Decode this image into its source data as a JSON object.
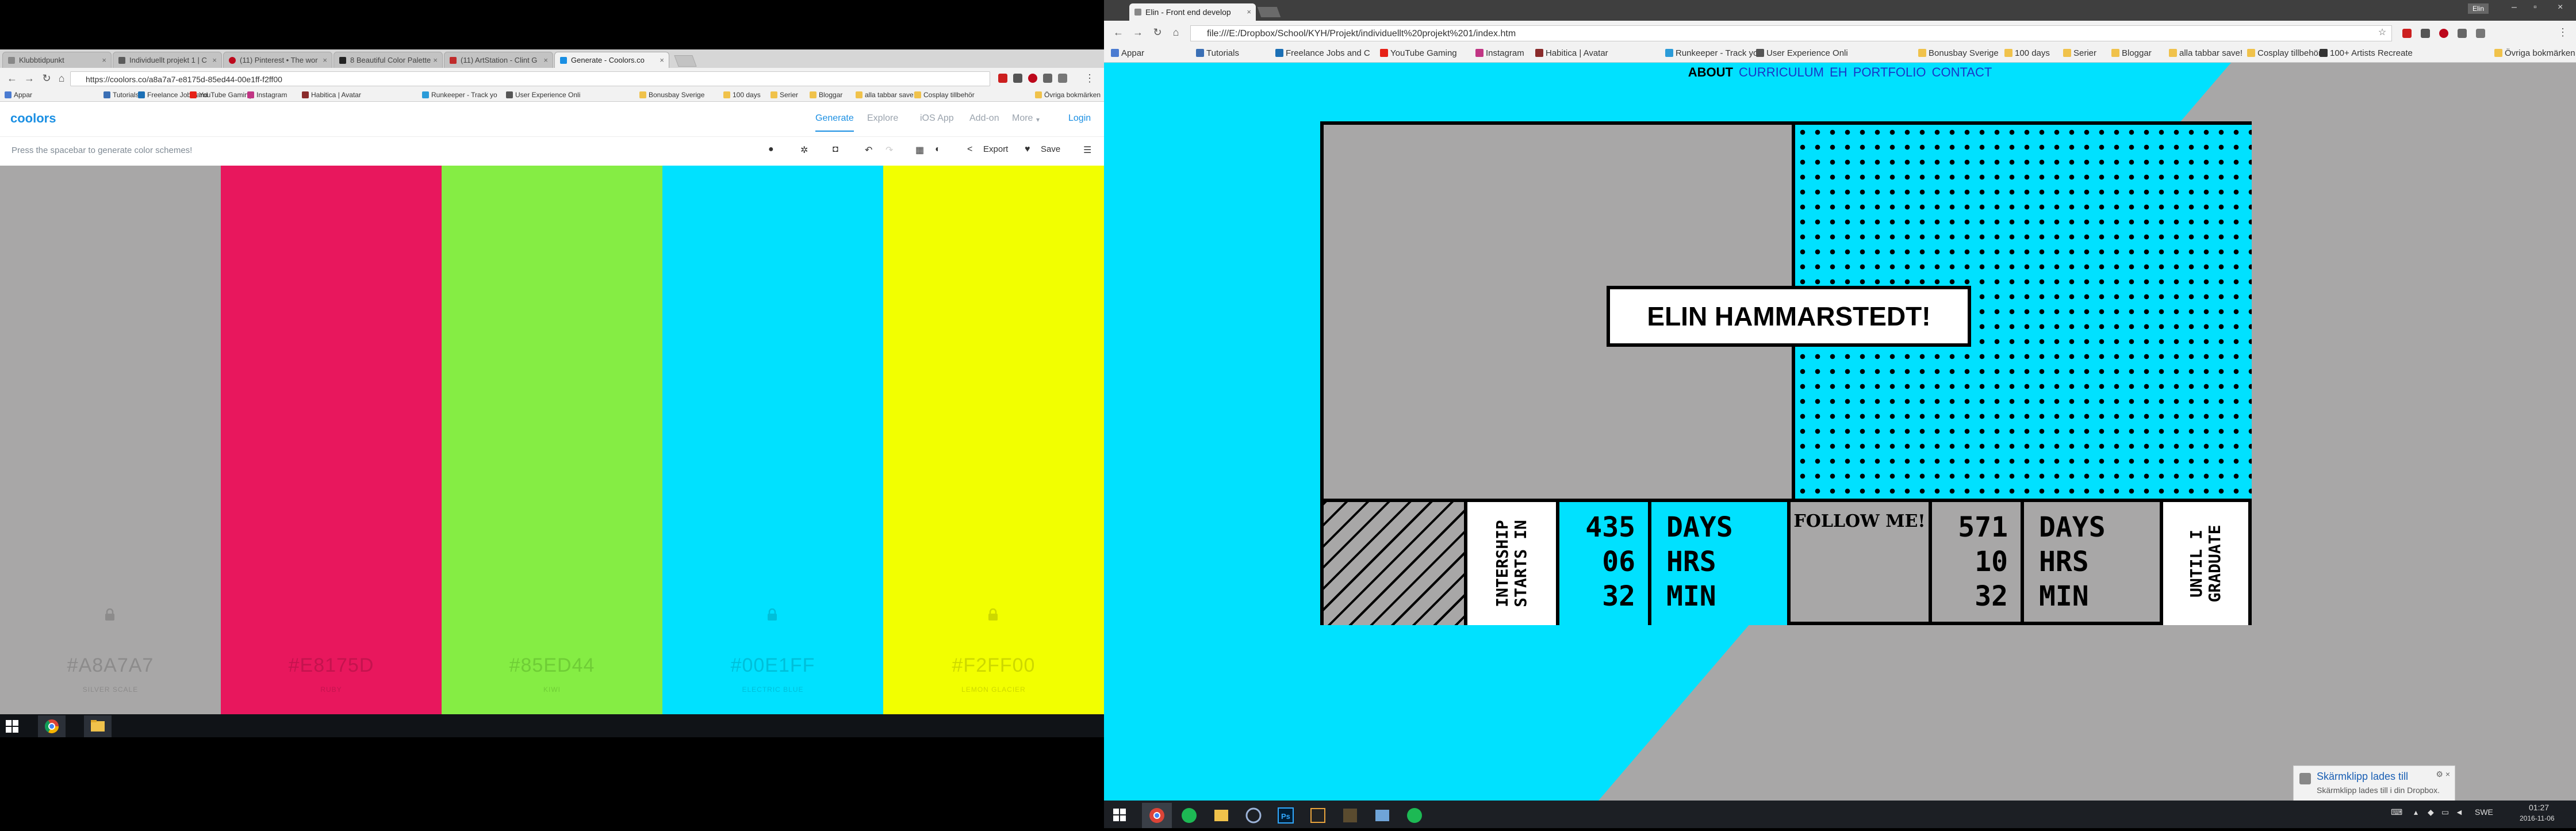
{
  "left_browser": {
    "tabs": [
      {
        "label": "Klubbtidpunkt"
      },
      {
        "label": "Individuellt projekt 1 | C"
      },
      {
        "label": "(11) Pinterest • The wor"
      },
      {
        "label": "8 Beautiful Color Palette"
      },
      {
        "label": "(11) ArtStation - Clint G"
      },
      {
        "label": "Generate - Coolors.co"
      }
    ],
    "url": "https://coolors.co/a8a7a7-e8175d-85ed44-00e1ff-f2ff00",
    "bookmarks": [
      "Appar",
      "Tutorials",
      "Freelance Jobs and",
      "YouTube Gaming",
      "Instagram",
      "Habitica | Avatar",
      "Runkeeper - Track yo",
      "User Experience Onli",
      "Bonusbay Sverige",
      "100 days",
      "Serier",
      "Bloggar",
      "alla tabbar save!",
      "Cosplay tillbehör",
      "Övriga bokmärken"
    ]
  },
  "coolors": {
    "logo": "coolors",
    "nav": {
      "generate": "Generate",
      "explore": "Explore",
      "ios_app": "iOS App",
      "addon": "Add-on",
      "more": "More",
      "login": "Login"
    },
    "hint": "Press the spacebar to generate color schemes!",
    "tools": {
      "export": "Export",
      "save": "Save"
    },
    "swatches": [
      {
        "hex": "#A8A7A7",
        "name": "SILVER SCALE",
        "color": "#a8a7a7",
        "text_color": "#8c8b8b",
        "locked": true
      },
      {
        "hex": "#E8175D",
        "name": "RUBY",
        "color": "#e8175d",
        "text_color": "#c4134e",
        "locked": false
      },
      {
        "hex": "#85ED44",
        "name": "KIWI",
        "color": "#85ed44",
        "text_color": "#6fcd36",
        "locked": false
      },
      {
        "hex": "#00E1FF",
        "name": "ELECTRIC BLUE",
        "color": "#00e1ff",
        "text_color": "#00bfd9",
        "locked": true
      },
      {
        "hex": "#F2FF00",
        "name": "LEMON GLACIER",
        "color": "#f2ff00",
        "text_color": "#cdd800",
        "locked": true
      }
    ]
  },
  "right_browser": {
    "tab": "Elin - Front end develop",
    "profile": "Elin",
    "url": "file:///E:/Dropbox/School/KYH/Projekt/individuellt%20projekt%201/index.htm",
    "bookmarks": [
      "Appar",
      "Tutorials",
      "Freelance Jobs and C",
      "YouTube Gaming",
      "Instagram",
      "Habitica | Avatar",
      "Runkeeper - Track yo",
      "User Experience Onli",
      "Bonusbay Sverige",
      "100 days",
      "Serier",
      "Bloggar",
      "alla tabbar save!",
      "Cosplay tillbehör",
      "100+ Artists Recreate",
      "Övriga bokmärken"
    ]
  },
  "site": {
    "nav": {
      "about": "ABOUT",
      "curriculum": "CURRICULUM",
      "eh": "EH",
      "portfolio": "PORTFOLIO",
      "contact": "CONTACT"
    },
    "name": "ELIN HAMMARSTEDT!",
    "internship_label": "INTERSHIP STARTS IN",
    "internship": {
      "days": "435",
      "hrs": "06",
      "min": "32"
    },
    "graduate_label": "UNTIL I GRADUATE",
    "graduate": {
      "days": "571",
      "hrs": "10",
      "min": "32"
    },
    "units": {
      "days": "DAYS",
      "hrs": "HRS",
      "min": "MIN"
    },
    "follow": "FOLLOW ME!"
  },
  "notification": {
    "title": "Skärmklipp lades till",
    "body": "Skärmklipp lades till i din Dropbox."
  },
  "tray": {
    "lang": "SWE",
    "time": "01:27",
    "date": "2016-11-06"
  }
}
